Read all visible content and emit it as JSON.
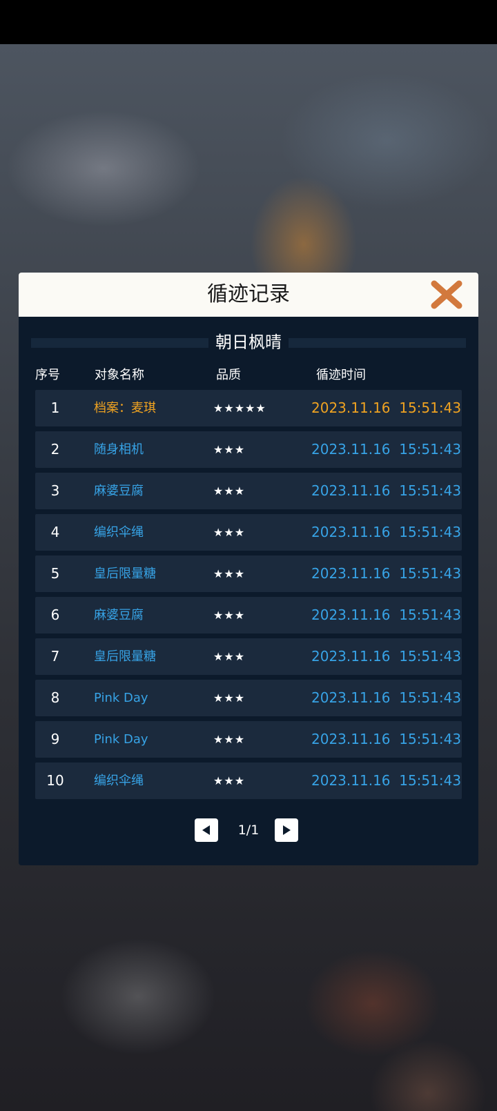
{
  "dialog": {
    "title": "循迹记录",
    "subtitle": "朝日枫晴",
    "columns": [
      "序号",
      "对象名称",
      "品质",
      "循迹时间"
    ],
    "rows": [
      {
        "index": "1",
        "name": "档案：麦琪",
        "stars": "★★★★★",
        "time": "2023.11.16  15:51:43",
        "highlight": true
      },
      {
        "index": "2",
        "name": "随身相机",
        "stars": "★★★",
        "time": "2023.11.16  15:51:43",
        "highlight": false
      },
      {
        "index": "3",
        "name": "麻婆豆腐",
        "stars": "★★★",
        "time": "2023.11.16  15:51:43",
        "highlight": false
      },
      {
        "index": "4",
        "name": "编织伞绳",
        "stars": "★★★",
        "time": "2023.11.16  15:51:43",
        "highlight": false
      },
      {
        "index": "5",
        "name": "皇后限量糖",
        "stars": "★★★",
        "time": "2023.11.16  15:51:43",
        "highlight": false
      },
      {
        "index": "6",
        "name": "麻婆豆腐",
        "stars": "★★★",
        "time": "2023.11.16  15:51:43",
        "highlight": false
      },
      {
        "index": "7",
        "name": "皇后限量糖",
        "stars": "★★★",
        "time": "2023.11.16  15:51:43",
        "highlight": false
      },
      {
        "index": "8",
        "name": "Pink Day",
        "stars": "★★★",
        "time": "2023.11.16  15:51:43",
        "highlight": false
      },
      {
        "index": "9",
        "name": "Pink Day",
        "stars": "★★★",
        "time": "2023.11.16  15:51:43",
        "highlight": false
      },
      {
        "index": "10",
        "name": "编织伞绳",
        "stars": "★★★",
        "time": "2023.11.16  15:51:43",
        "highlight": false
      }
    ],
    "pager": {
      "text": "1/1"
    }
  },
  "icons": {
    "close": "close-x-icon",
    "prev": "caret-left-icon",
    "next": "caret-right-icon"
  },
  "colors": {
    "highlight": "#f0a321",
    "normal": "#37a3e6",
    "close": "#d2793d"
  }
}
